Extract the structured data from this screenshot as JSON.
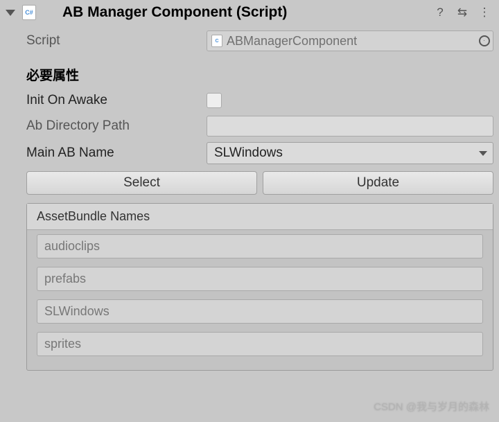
{
  "header": {
    "title": "AB Manager Component (Script)",
    "icons": {
      "help": "?",
      "preset": "⇆",
      "menu": "⋮"
    }
  },
  "fields": {
    "script": {
      "label": "Script",
      "value": "ABManagerComponent"
    },
    "section": "必要属性",
    "init_on_awake": {
      "label": "Init On Awake",
      "checked": false
    },
    "ab_directory_path": {
      "label": "Ab Directory Path",
      "value": ""
    },
    "main_ab_name": {
      "label": "Main AB Name",
      "value": "SLWindows"
    }
  },
  "buttons": {
    "select": "Select",
    "update": "Update"
  },
  "list": {
    "header": "AssetBundle Names",
    "items": [
      "audioclips",
      "prefabs",
      "SLWindows",
      "sprites"
    ]
  },
  "watermark": "CSDN @我与岁月的森林"
}
